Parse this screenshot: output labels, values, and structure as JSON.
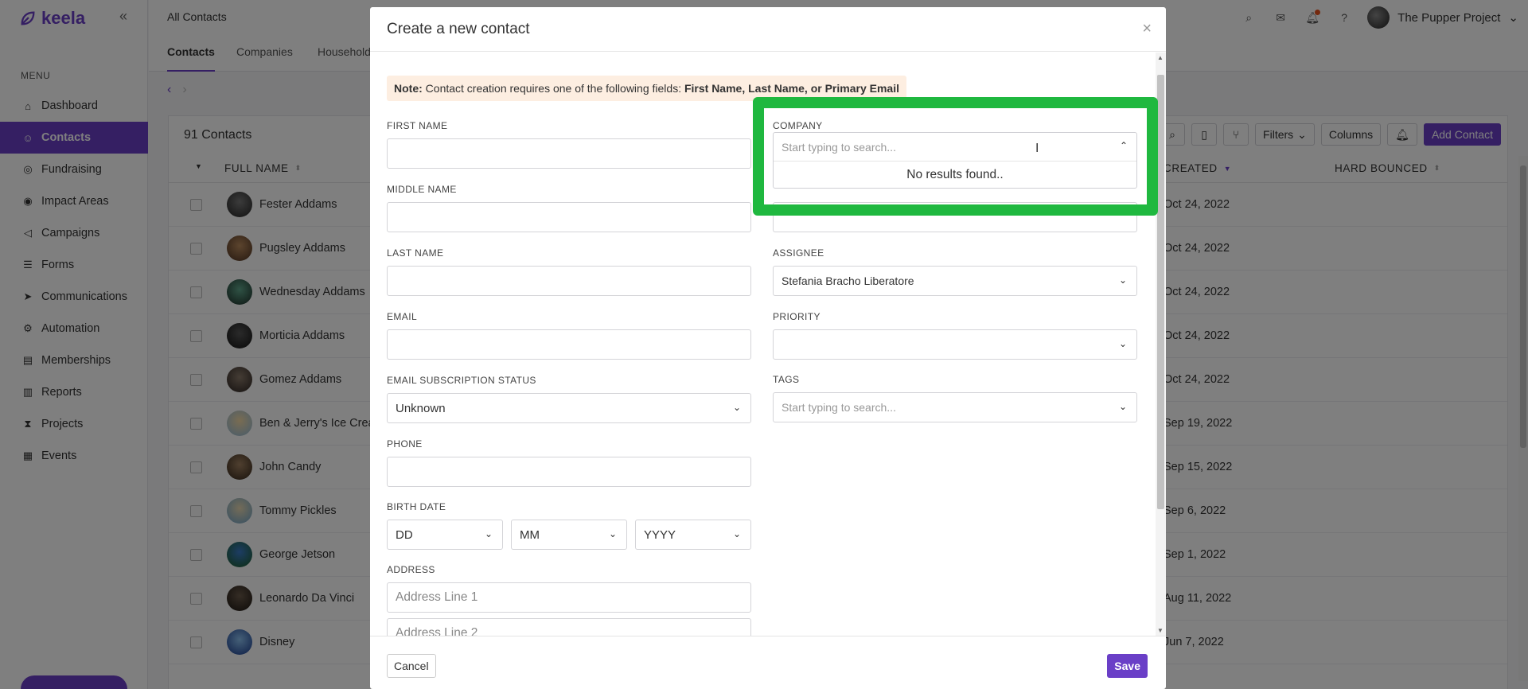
{
  "app": {
    "logo_text": "keela",
    "account_name": "The Pupper Project",
    "accent_color": "#6a3fc7"
  },
  "sidebar": {
    "menu_title": "MENU",
    "items": [
      {
        "label": "Dashboard",
        "icon": "home-icon"
      },
      {
        "label": "Contacts",
        "icon": "user-icon",
        "active": true
      },
      {
        "label": "Fundraising",
        "icon": "donation-icon"
      },
      {
        "label": "Impact Areas",
        "icon": "target-icon"
      },
      {
        "label": "Campaigns",
        "icon": "megaphone-icon"
      },
      {
        "label": "Forms",
        "icon": "form-icon"
      },
      {
        "label": "Communications",
        "icon": "send-icon"
      },
      {
        "label": "Automation",
        "icon": "automation-icon"
      },
      {
        "label": "Memberships",
        "icon": "membership-card-icon"
      },
      {
        "label": "Reports",
        "icon": "report-icon"
      },
      {
        "label": "Projects",
        "icon": "hourglass-icon"
      },
      {
        "label": "Events",
        "icon": "calendar-icon"
      }
    ]
  },
  "header": {
    "page_title": "All Contacts",
    "tabs": [
      "Contacts",
      "Companies",
      "Household"
    ]
  },
  "contacts": {
    "count_label": "91 Contacts",
    "columns": {
      "full_name": "FULL NAME",
      "created": "CREATED",
      "hard_bounced": "HARD BOUNCED"
    },
    "toolbar": {
      "filters": "Filters",
      "columns": "Columns",
      "add_contact": "Add Contact"
    },
    "rows": [
      {
        "name": "Fester Addams",
        "created": "Oct 24, 2022"
      },
      {
        "name": "Pugsley Addams",
        "created": "Oct 24, 2022"
      },
      {
        "name": "Wednesday Addams",
        "created": "Oct 24, 2022"
      },
      {
        "name": "Morticia Addams",
        "created": "Oct 24, 2022"
      },
      {
        "name": "Gomez Addams",
        "created": "Oct 24, 2022"
      },
      {
        "name": "Ben & Jerry's Ice Crea",
        "created": "Sep 19, 2022"
      },
      {
        "name": "John Candy",
        "created": "Sep 15, 2022"
      },
      {
        "name": "Tommy Pickles",
        "created": "Sep 6, 2022"
      },
      {
        "name": "George Jetson",
        "created": "Sep 1, 2022"
      },
      {
        "name": "Leonardo Da Vinci",
        "created": "Aug 11, 2022"
      },
      {
        "name": "Disney",
        "created": "Jun 7, 2022"
      }
    ]
  },
  "modal": {
    "title": "Create a new contact",
    "close": "×",
    "note_label": "Note:",
    "note_text": "Contact creation requires one of the following fields:",
    "note_fields": "First Name, Last Name, or Primary Email",
    "fields": {
      "first_name": "FIRST NAME",
      "middle_name": "MIDDLE NAME",
      "last_name": "LAST NAME",
      "email": "EMAIL",
      "email_subscription_status": "EMAIL SUBSCRIPTION STATUS",
      "email_subscription_value": "Unknown",
      "phone": "PHONE",
      "birth_date": "BIRTH DATE",
      "birth_dd": "DD",
      "birth_mm": "MM",
      "birth_yyyy": "YYYY",
      "address": "ADDRESS",
      "address_line1_placeholder": "Address Line 1",
      "address_line2_placeholder": "Address Line 2",
      "company": "COMPANY",
      "company_placeholder": "Start typing to search...",
      "company_no_results": "No results found..",
      "assignee": "ASSIGNEE",
      "assignee_value": "Stefania Bracho Liberatore",
      "priority": "PRIORITY",
      "tags": "TAGS",
      "tags_placeholder": "Start typing to search..."
    },
    "cancel_label": "Cancel",
    "save_label": "Save"
  }
}
